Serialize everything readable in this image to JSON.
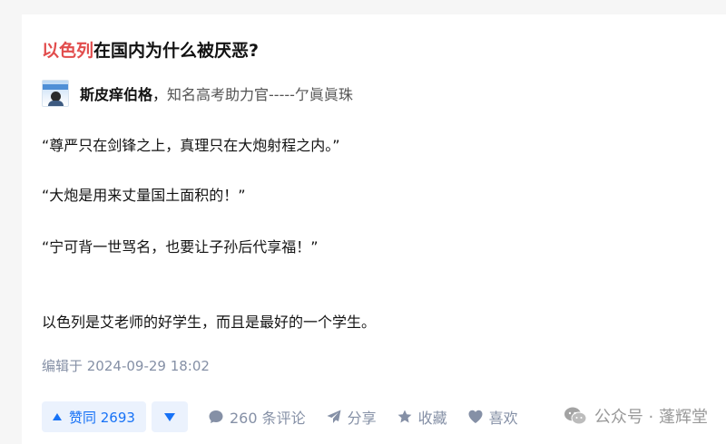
{
  "question": {
    "title_highlight": "以色列",
    "title_rest": "在国内为什么被厌恶?"
  },
  "author": {
    "name": "斯皮痒伯格",
    "separator": "，",
    "bio": "知名高考助力官-----亇眞眞珠"
  },
  "content": {
    "paragraphs": [
      "“尊严只在剑锋之上，真理只在大炮射程之内。”",
      "“大炮是用来丈量国土面积的！”",
      "“宁可背一世骂名，也要让子孙后代享福！”",
      "以色列是艾老师的好学生，而且是最好的一个学生。"
    ]
  },
  "meta": {
    "edited": "编辑于 2024-09-29 18:02"
  },
  "actions": {
    "upvote_label": "赞同 2693",
    "comments_label": "260 条评论",
    "share_label": "分享",
    "favorite_label": "收藏",
    "like_label": "喜欢"
  },
  "watermark": {
    "text": "公众号 · 蓬辉堂"
  },
  "colors": {
    "accent": "#1772f6",
    "highlight": "#e24d4d",
    "muted": "#8590a6"
  },
  "icons": {
    "upvote": "triangle-up-icon",
    "downvote": "triangle-down-icon",
    "comment": "comment-bubble-icon",
    "share": "paper-plane-icon",
    "favorite": "star-icon",
    "like": "heart-icon",
    "watermark": "wechat-icon"
  }
}
